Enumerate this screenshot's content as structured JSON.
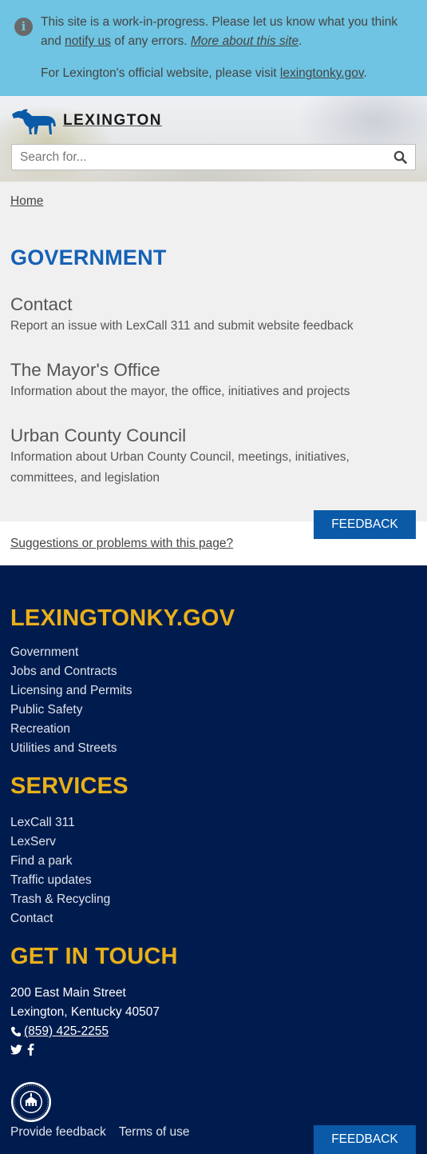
{
  "notice": {
    "line1": "This site is a work-in-progress. Please let us know what you think",
    "line2_pre": "and ",
    "notify_link": "notify us",
    "line2_mid": " of any errors. ",
    "more_link": "More about this site",
    "line2_post": ".",
    "line3_pre": "For Lexington's official website, please visit ",
    "official_link": "lexingtonky.gov",
    "line3_post": "."
  },
  "header": {
    "wordmark": "LEXINGTON",
    "search_placeholder": "Search for..."
  },
  "breadcrumb": {
    "home": "Home"
  },
  "main": {
    "title": "GOVERNMENT",
    "items": [
      {
        "title": "Contact",
        "description": "Report an issue with LexCall 311 and submit website feedback"
      },
      {
        "title": "The Mayor's Office",
        "description": "Information about the mayor, the office, initiatives and projects"
      },
      {
        "title": "Urban County Council",
        "description_line1": "Information about Urban County Council, meetings, initiatives,",
        "description_line2": "committees, and legislation"
      }
    ]
  },
  "feedback": {
    "button_label": "FEEDBACK",
    "suggestions_link": "Suggestions or problems with this page?"
  },
  "footer": {
    "site_heading": "LEXINGTONKY.GOV",
    "site_links": [
      "Government",
      "Jobs and Contracts",
      "Licensing and Permits",
      "Public Safety",
      "Recreation",
      "Utilities and Streets"
    ],
    "services_heading": "SERVICES",
    "services_links": [
      "LexCall 311",
      "LexServ",
      "Find a park",
      "Traffic updates",
      "Trash & Recycling",
      "Contact"
    ],
    "touch_heading": "GET IN TOUCH",
    "address_line1": "200 East Main Street",
    "address_line2": "Lexington, Kentucky 40507",
    "phone": "(859) 425-2255",
    "provide_feedback": "Provide feedback",
    "terms": "Terms of use",
    "button_label": "FEEDBACK"
  },
  "colors": {
    "notice_bg": "#6ec4e2",
    "title_blue": "#1561b5",
    "button_blue": "#0b5aa8",
    "footer_bg": "#001c4f",
    "footer_heading": "#e9b019"
  },
  "icons": [
    "info-icon",
    "horse-logo-icon",
    "search-icon",
    "phone-icon",
    "twitter-icon",
    "facebook-icon",
    "city-seal-icon"
  ]
}
